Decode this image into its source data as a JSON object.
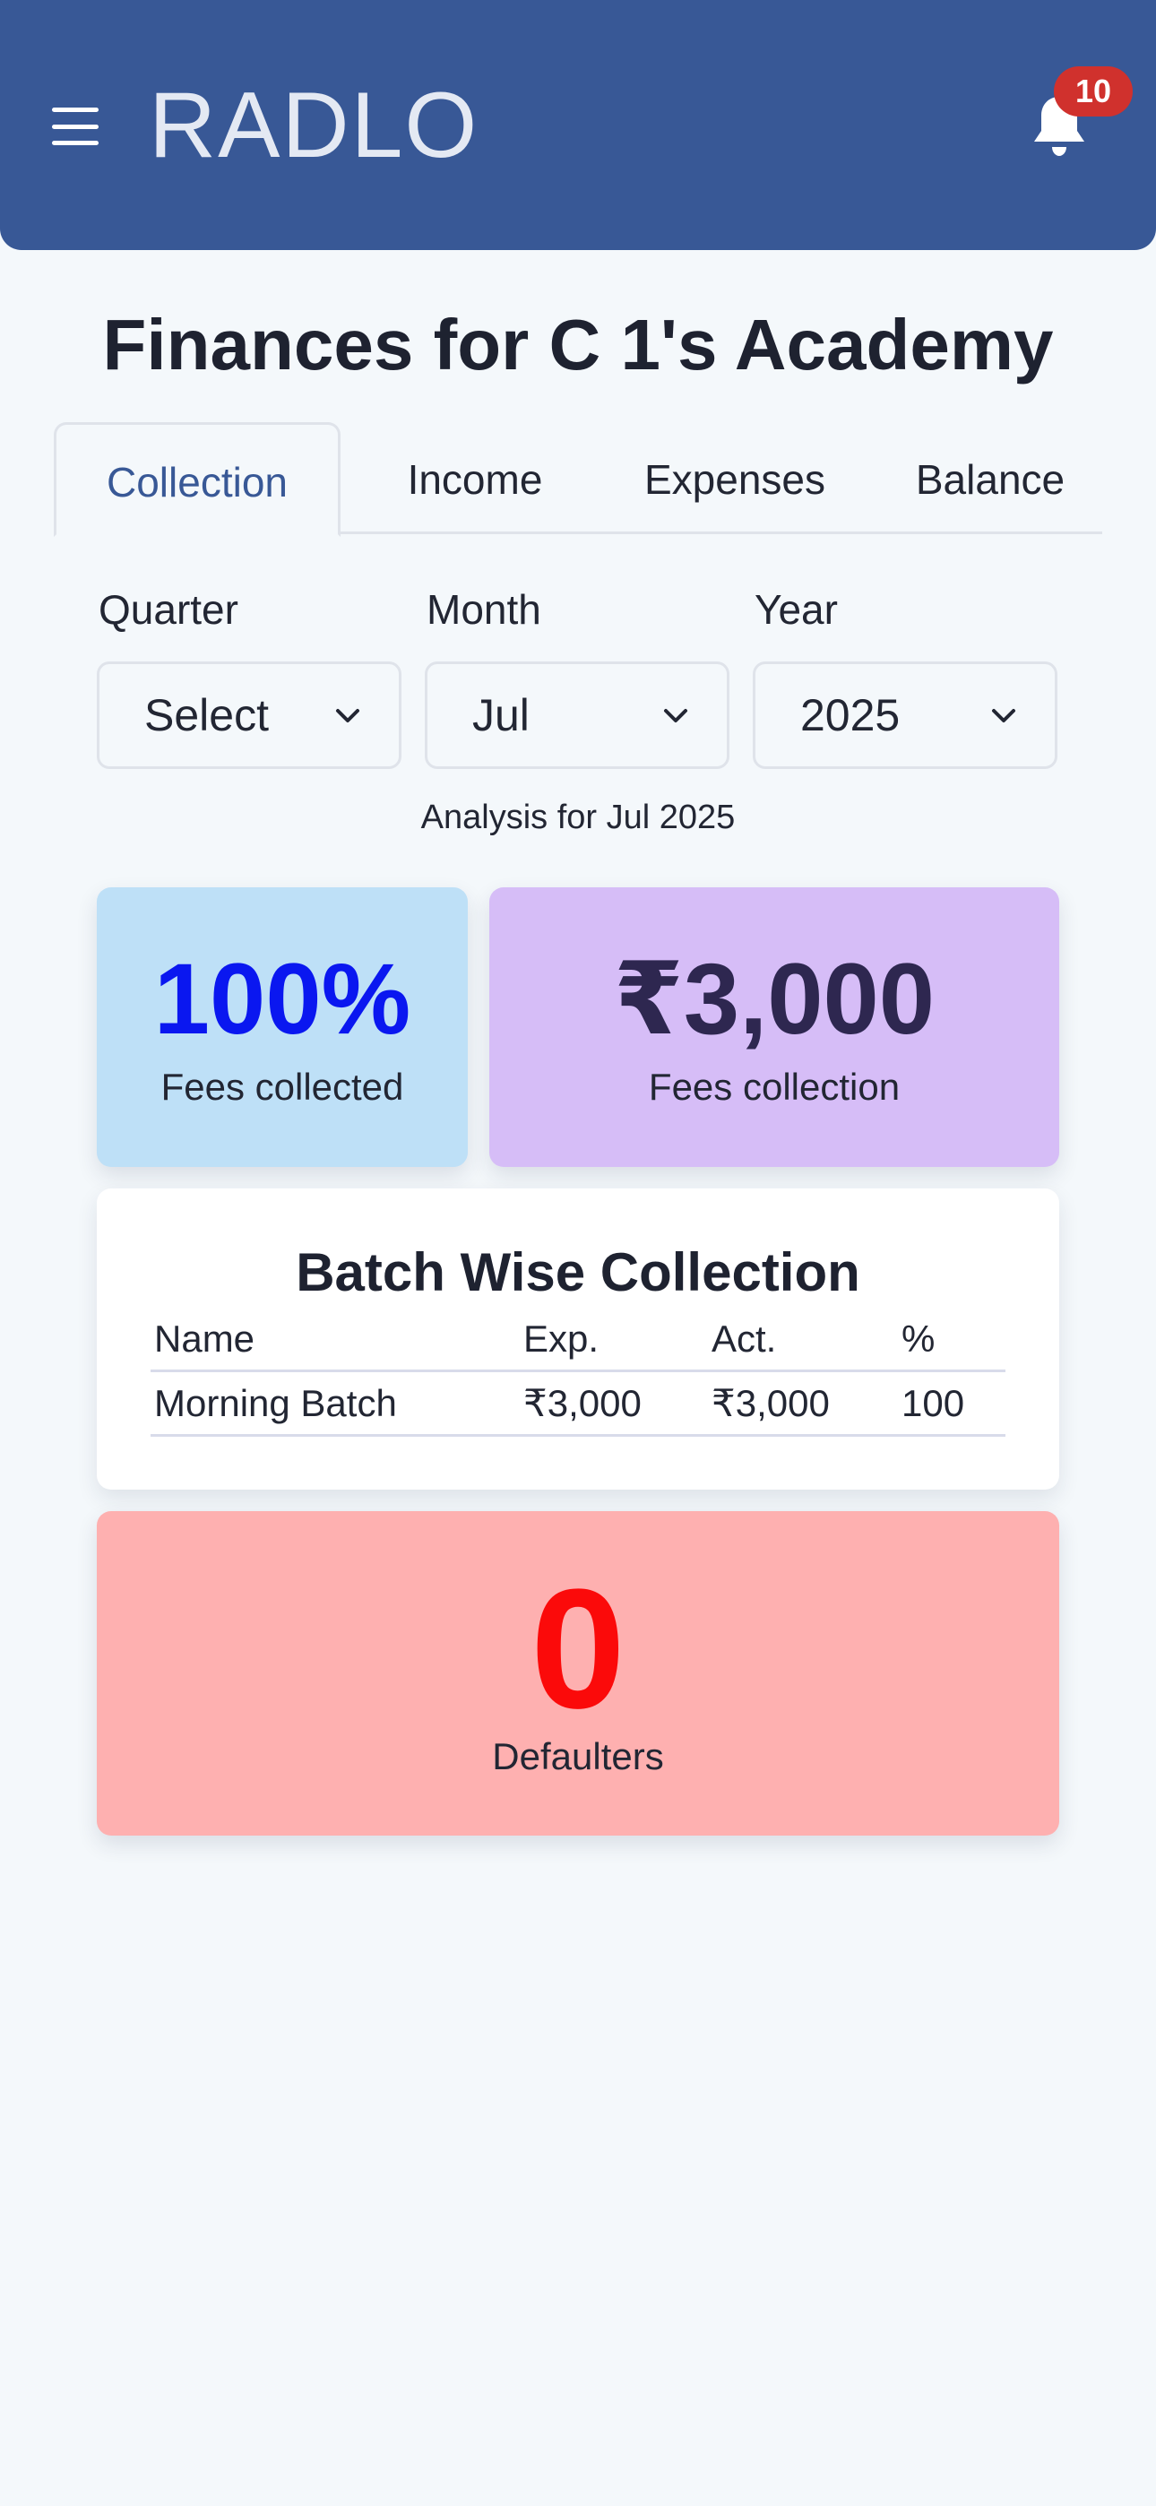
{
  "header": {
    "brand": "RADLO",
    "notification_count": "10",
    "bg_color": "#385896"
  },
  "page": {
    "title": "Finances for C 1's Academy"
  },
  "tabs": [
    {
      "label": "Collection",
      "active": true
    },
    {
      "label": "Income",
      "active": false
    },
    {
      "label": "Expenses",
      "active": false
    },
    {
      "label": "Balance",
      "active": false
    }
  ],
  "filters": {
    "quarter": {
      "label": "Quarter",
      "value": "Select"
    },
    "month": {
      "label": "Month",
      "value": "Jul"
    },
    "year": {
      "label": "Year",
      "value": "2025"
    }
  },
  "analysis_text": "Analysis for Jul 2025",
  "stats": {
    "fees_collected_pct": "100%",
    "fees_collected_label": "Fees collected",
    "fees_collection_amount": "₹3,000",
    "fees_collection_label": "Fees collection"
  },
  "batch": {
    "title": "Batch Wise Collection",
    "columns": [
      "Name",
      "Exp.",
      "Act.",
      "%"
    ],
    "rows": [
      [
        "Morning Batch",
        "₹3,000",
        "₹3,000",
        "100"
      ]
    ]
  },
  "defaulters": {
    "count": "0",
    "label": "Defaulters"
  },
  "colors": {
    "card_blue": "#bee0f7",
    "card_purple": "#d6bdf7",
    "card_red": "#feb0b0",
    "pct_text": "#0a17f0",
    "defaulter_text": "#fb0a0a"
  }
}
